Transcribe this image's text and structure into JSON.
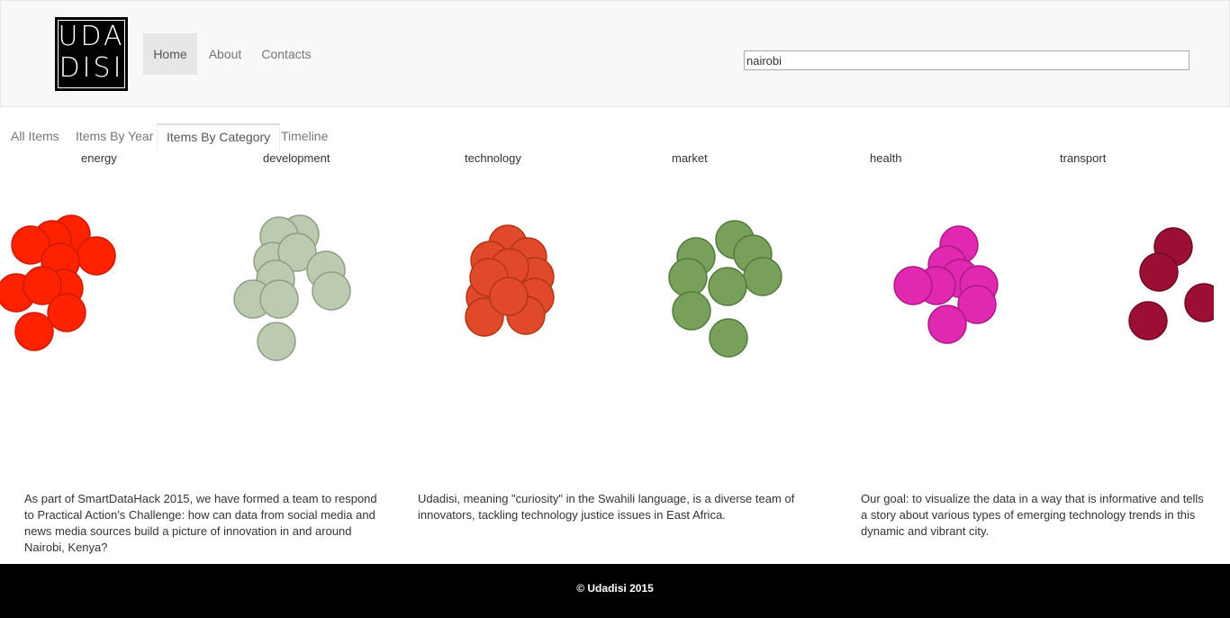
{
  "brand": {
    "logo_line1": "UDA",
    "logo_line2": "DISI"
  },
  "nav": {
    "items": [
      {
        "label": "Home",
        "active": true
      },
      {
        "label": "About"
      },
      {
        "label": "Contacts"
      }
    ]
  },
  "search": {
    "value": "nairobi"
  },
  "tabs": [
    {
      "label": "All Items"
    },
    {
      "label": "Items By Year"
    },
    {
      "label": "Items By Category",
      "active": true
    },
    {
      "label": "Timeline"
    }
  ],
  "categories": [
    {
      "name": "energy",
      "color": "#ff2200",
      "stroke": "#cc1b00",
      "count": 11
    },
    {
      "name": "development",
      "color": "#bccbb0",
      "stroke": "#8e9e86",
      "count": 11
    },
    {
      "name": "technology",
      "color": "#e04a2a",
      "stroke": "#b23518",
      "count": 12
    },
    {
      "name": "market",
      "color": "#78a05a",
      "stroke": "#557a3e",
      "count": 9
    },
    {
      "name": "health",
      "color": "#e028b0",
      "stroke": "#aa1a85",
      "count": 8
    },
    {
      "name": "transport",
      "color": "#9a0f33",
      "stroke": "#700a24",
      "count": 4
    }
  ],
  "content": {
    "p1": "As part of SmartDataHack 2015, we have formed a team to respond to Practical Action's Challenge: how can data from social media and news media sources build a picture of innovation in and around Nairobi, Kenya?",
    "p2": "Udadisi, meaning \"curiosity\" in the Swahili language, is a diverse team of innovators, tackling technology justice issues in East Africa.",
    "p3": "Our goal: to visualize the data in a way that is informative and tells a story about various types of emerging technology trends in this dynamic and vibrant city."
  },
  "footer": {
    "text": "© Udadisi 2015"
  }
}
